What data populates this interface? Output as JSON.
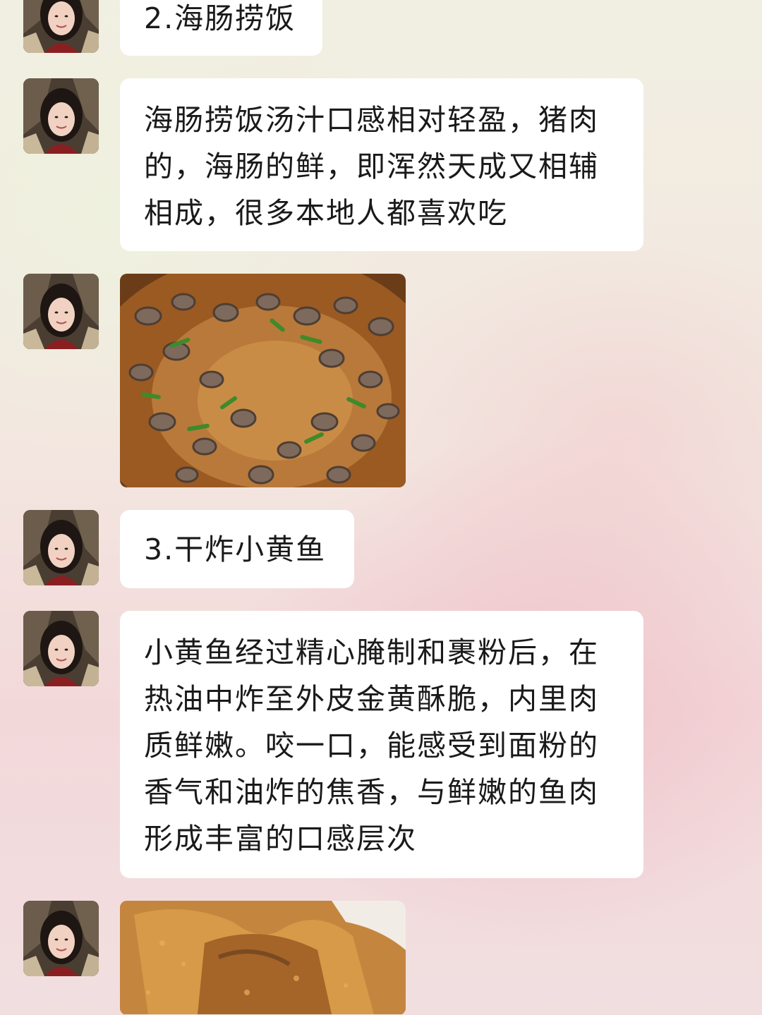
{
  "messages": [
    {
      "type": "text",
      "text": "2.海肠捞饭"
    },
    {
      "type": "text",
      "text": "海肠捞饭汤汁口感相对轻盈，猪肉的，海肠的鲜，即浑然天成又相辅相成，很多本地人都喜欢吃"
    },
    {
      "type": "image",
      "subject": "海肠捞饭"
    },
    {
      "type": "text",
      "text": "3.干炸小黄鱼"
    },
    {
      "type": "text",
      "text": "小黄鱼经过精心腌制和裹粉后，在热油中炸至外皮金黄酥脆，内里肉质鲜嫩。咬一口，能感受到面粉的香气和油炸的焦香，与鲜嫩的鱼肉形成丰富的口感层次"
    },
    {
      "type": "image",
      "subject": "干炸小黄鱼"
    }
  ],
  "colors": {
    "bubble": "#ffffff",
    "text": "#1a1a1a"
  }
}
